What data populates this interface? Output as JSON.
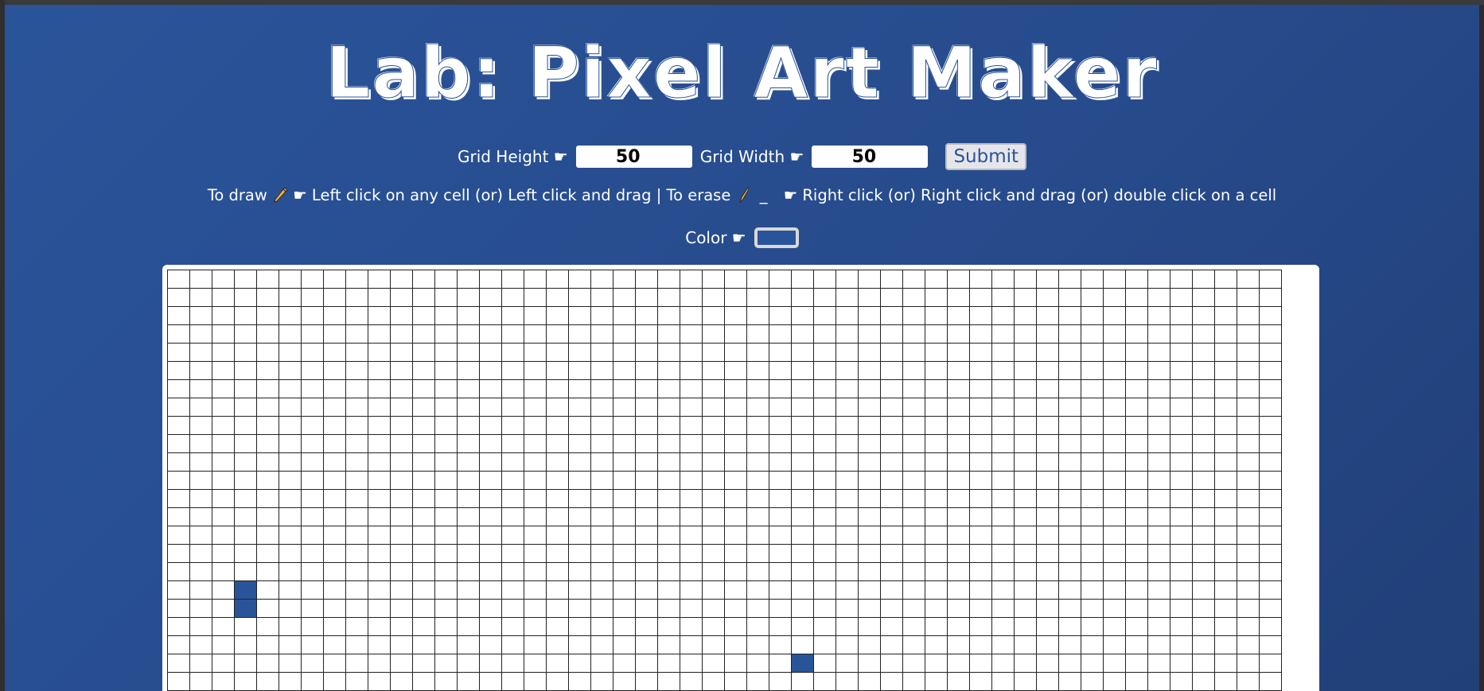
{
  "page": {
    "title": "Lab: Pixel Art Maker"
  },
  "controls": {
    "height_label": "Grid Height ☛",
    "height_value": "50",
    "width_label": "Grid Width ☛",
    "width_value": "50",
    "submit_label": "Submit"
  },
  "instructions": {
    "draw_prefix": "To draw",
    "draw_text": "☛ Left click on any cell (or) Left click and drag",
    "separator": "|",
    "erase_prefix": "To erase",
    "erase_mark": "_",
    "erase_text": "☛ Right click (or) Right click and drag (or) double click on a cell"
  },
  "color": {
    "label": "Color ☛",
    "value": "#2a549a"
  },
  "grid": {
    "rows": 50,
    "cols": 50,
    "filled_cells": [
      [
        17,
        3
      ],
      [
        18,
        3
      ],
      [
        21,
        28
      ]
    ],
    "fill_color": "#2a549a"
  },
  "icons": {
    "draw": "pencil-icon",
    "erase": "eraser-pencil-icon"
  }
}
